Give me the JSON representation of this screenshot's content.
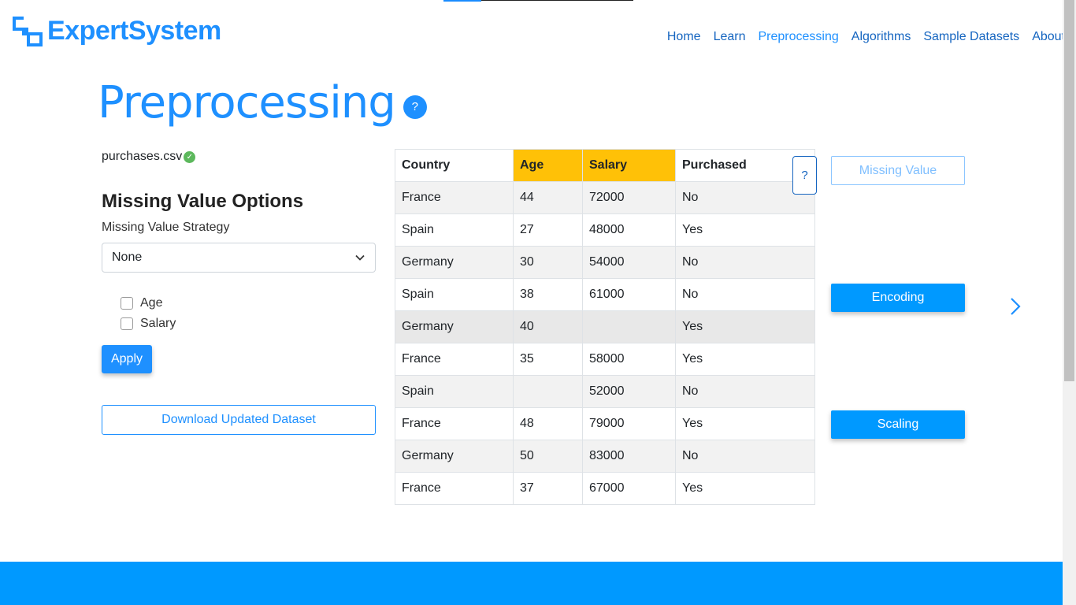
{
  "brand": {
    "name": "ExpertSystem"
  },
  "nav": [
    "Home",
    "Learn",
    "Preprocessing",
    "Algorithms",
    "Sample Datasets",
    "About"
  ],
  "nav_active": "Preprocessing",
  "page": {
    "title": "Preprocessing",
    "help": "?"
  },
  "left": {
    "filename": "purchases.csv",
    "section_title": "Missing Value Options",
    "strategy_label": "Missing Value Strategy",
    "strategy_value": "None",
    "columns": [
      {
        "label": "Age",
        "checked": false
      },
      {
        "label": "Salary",
        "checked": false
      }
    ],
    "apply": "Apply",
    "download": "Download Updated Dataset"
  },
  "table": {
    "headers": [
      "Country",
      "Age",
      "Salary",
      "Purchased"
    ],
    "highlighted_headers": [
      "Age",
      "Salary"
    ],
    "rows": [
      [
        "France",
        "44",
        "72000",
        "No"
      ],
      [
        "Spain",
        "27",
        "48000",
        "Yes"
      ],
      [
        "Germany",
        "30",
        "54000",
        "No"
      ],
      [
        "Spain",
        "38",
        "61000",
        "No"
      ],
      [
        "Germany",
        "40",
        "",
        "Yes"
      ],
      [
        "France",
        "35",
        "58000",
        "Yes"
      ],
      [
        "Spain",
        "",
        "52000",
        "No"
      ],
      [
        "France",
        "48",
        "79000",
        "Yes"
      ],
      [
        "Germany",
        "50",
        "83000",
        "No"
      ],
      [
        "France",
        "37",
        "67000",
        "Yes"
      ]
    ],
    "help": "?"
  },
  "steps": {
    "missing": "Missing Value",
    "encoding": "Encoding",
    "scaling": "Scaling"
  },
  "colors": {
    "accent": "#1e90ff",
    "highlight": "#ffc107",
    "footer": "#0099ff"
  }
}
